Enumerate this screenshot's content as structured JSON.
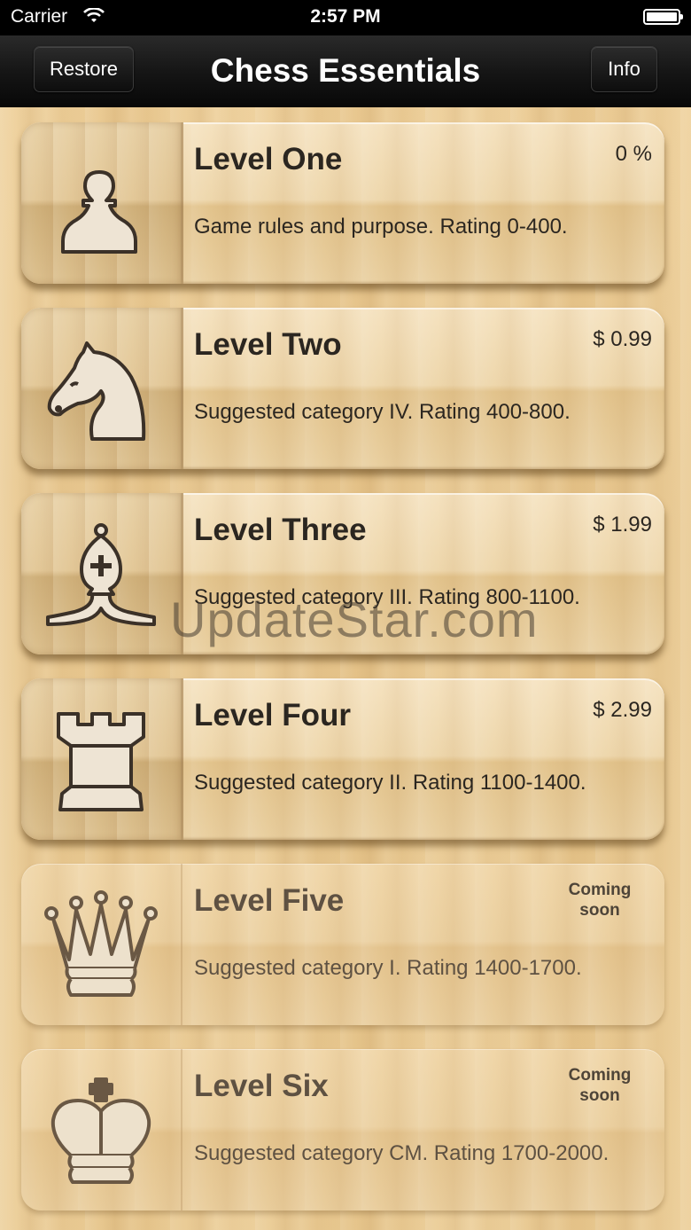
{
  "status_bar": {
    "carrier": "Carrier",
    "time": "2:57 PM"
  },
  "nav": {
    "title": "Chess Essentials",
    "restore_label": "Restore",
    "info_label": "Info"
  },
  "levels": [
    {
      "title": "Level One",
      "price": "0 %",
      "description": "Game rules and purpose. Rating 0-400.",
      "icon": "pawn-icon"
    },
    {
      "title": "Level Two",
      "price": "$ 0.99",
      "description": "Suggested category IV. Rating 400-800.",
      "icon": "knight-icon"
    },
    {
      "title": "Level Three",
      "price": "$ 1.99",
      "description": "Suggested category III. Rating 800-1100.",
      "icon": "bishop-icon"
    },
    {
      "title": "Level Four",
      "price": "$ 2.99",
      "description": "Suggested category II. Rating 1100-1400.",
      "icon": "rook-icon"
    },
    {
      "title": "Level Five",
      "price": "Coming soon",
      "description": "Suggested category I. Rating 1400-1700.",
      "icon": "queen-icon"
    },
    {
      "title": "Level Six",
      "price": "Coming soon",
      "description": "Suggested category CM. Rating 1700-2000.",
      "icon": "king-icon"
    }
  ],
  "watermark": "UpdateStar.com",
  "colors": {
    "nav_background": "#111111",
    "card_text": "#2b2620",
    "piece_fill": "#eee4d4",
    "piece_stroke": "#3b3128"
  }
}
